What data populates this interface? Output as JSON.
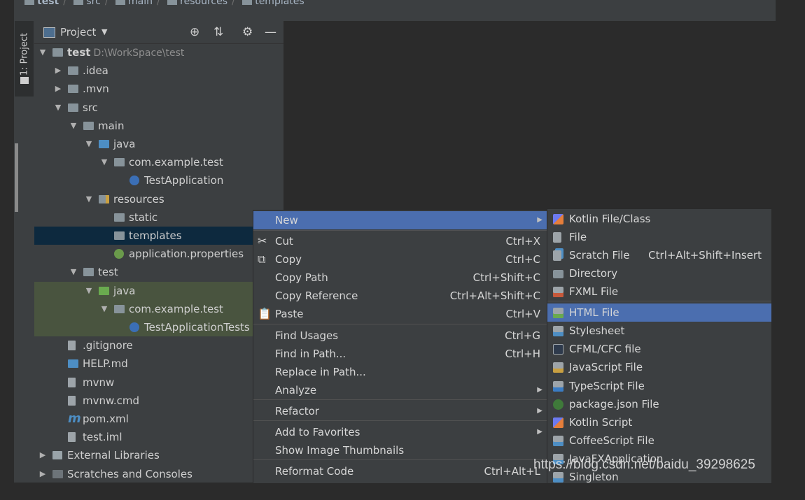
{
  "breadcrumbs": [
    "test",
    "src",
    "main",
    "resources",
    "templates"
  ],
  "tool_window_tab": "1: Project",
  "panel": {
    "title": "Project"
  },
  "tree": [
    {
      "label": "test",
      "sub": "D:\\WorkSpace\\test",
      "arrow": "▼",
      "icon": "folder",
      "bold": true
    },
    {
      "label": ".idea",
      "arrow": "▶",
      "icon": "folder"
    },
    {
      "label": ".mvn",
      "arrow": "▶",
      "icon": "folder"
    },
    {
      "label": "src",
      "arrow": "▼",
      "icon": "folder"
    },
    {
      "label": "main",
      "arrow": "▼",
      "icon": "folder"
    },
    {
      "label": "java",
      "arrow": "▼",
      "icon": "blue"
    },
    {
      "label": "com.example.test",
      "arrow": "▼",
      "icon": "pkg"
    },
    {
      "label": "TestApplication",
      "arrow": "",
      "icon": "app"
    },
    {
      "label": "resources",
      "arrow": "▼",
      "icon": "res"
    },
    {
      "label": "static",
      "arrow": "",
      "icon": "pkg"
    },
    {
      "label": "templates",
      "arrow": "",
      "icon": "pkg",
      "selected": true
    },
    {
      "label": "application.properties",
      "arrow": "",
      "icon": "cfg"
    },
    {
      "label": "test",
      "arrow": "▼",
      "icon": "folder"
    },
    {
      "label": "java",
      "arrow": "▼",
      "icon": "green",
      "testbg": true
    },
    {
      "label": "com.example.test",
      "arrow": "▼",
      "icon": "pkg",
      "testbg": true
    },
    {
      "label": "TestApplicationTests",
      "arrow": "",
      "icon": "app",
      "testbg": true
    },
    {
      "label": ".gitignore",
      "arrow": "",
      "icon": "file"
    },
    {
      "label": "HELP.md",
      "arrow": "",
      "icon": "md"
    },
    {
      "label": "mvnw",
      "arrow": "",
      "icon": "file"
    },
    {
      "label": "mvnw.cmd",
      "arrow": "",
      "icon": "file"
    },
    {
      "label": "pom.xml",
      "arrow": "",
      "icon": "maven"
    },
    {
      "label": "test.iml",
      "arrow": "",
      "icon": "file"
    },
    {
      "label": "External Libraries",
      "arrow": "▶",
      "icon": "lib"
    },
    {
      "label": "Scratches and Consoles",
      "arrow": "▶",
      "icon": "scr"
    }
  ],
  "context_menu": {
    "items": [
      {
        "label": "New",
        "shortcut": "",
        "submenu": true,
        "highlighted": true
      },
      {
        "label": "Cut",
        "shortcut": "Ctrl+X",
        "icon": "✂"
      },
      {
        "label": "Copy",
        "shortcut": "Ctrl+C",
        "icon": "⧉"
      },
      {
        "label": "Copy Path",
        "shortcut": "Ctrl+Shift+C"
      },
      {
        "label": "Copy Reference",
        "shortcut": "Ctrl+Alt+Shift+C"
      },
      {
        "label": "Paste",
        "shortcut": "Ctrl+V",
        "icon": "📋"
      },
      {
        "label": "Find Usages",
        "shortcut": "Ctrl+G"
      },
      {
        "label": "Find in Path...",
        "shortcut": "Ctrl+H"
      },
      {
        "label": "Replace in Path...",
        "shortcut": ""
      },
      {
        "label": "Analyze",
        "shortcut": "",
        "submenu": true
      },
      {
        "label": "Refactor",
        "shortcut": "",
        "submenu": true
      },
      {
        "label": "Add to Favorites",
        "shortcut": "",
        "submenu": true
      },
      {
        "label": "Show Image Thumbnails",
        "shortcut": ""
      },
      {
        "label": "Reformat Code",
        "shortcut": "Ctrl+Alt+L"
      }
    ]
  },
  "new_submenu": {
    "items": [
      {
        "label": "Kotlin File/Class",
        "shortcut": "",
        "icon": "kotlin"
      },
      {
        "label": "File",
        "shortcut": "",
        "icon": "file"
      },
      {
        "label": "Scratch File",
        "shortcut": "Ctrl+Alt+Shift+Insert",
        "icon": "scratch"
      },
      {
        "label": "Directory",
        "shortcut": "",
        "icon": "dir"
      },
      {
        "label": "FXML File",
        "shortcut": "",
        "icon": "fxml"
      },
      {
        "label": "HTML File",
        "shortcut": "",
        "icon": "html",
        "highlighted": true
      },
      {
        "label": "Stylesheet",
        "shortcut": "",
        "icon": "css"
      },
      {
        "label": "CFML/CFC file",
        "shortcut": "",
        "icon": "cfml"
      },
      {
        "label": "JavaScript File",
        "shortcut": "",
        "icon": "js"
      },
      {
        "label": "TypeScript File",
        "shortcut": "",
        "icon": "ts"
      },
      {
        "label": "package.json File",
        "shortcut": "",
        "icon": "node"
      },
      {
        "label": "Kotlin Script",
        "shortcut": "",
        "icon": "kotlin"
      },
      {
        "label": "CoffeeScript File",
        "shortcut": "",
        "icon": "coffee"
      },
      {
        "label": "JavaFXApplication",
        "shortcut": "",
        "icon": "fx"
      },
      {
        "label": "Singleton",
        "shortcut": "",
        "icon": "single"
      }
    ]
  },
  "watermark": "https://blog.csdn.net/baidu_39298625"
}
